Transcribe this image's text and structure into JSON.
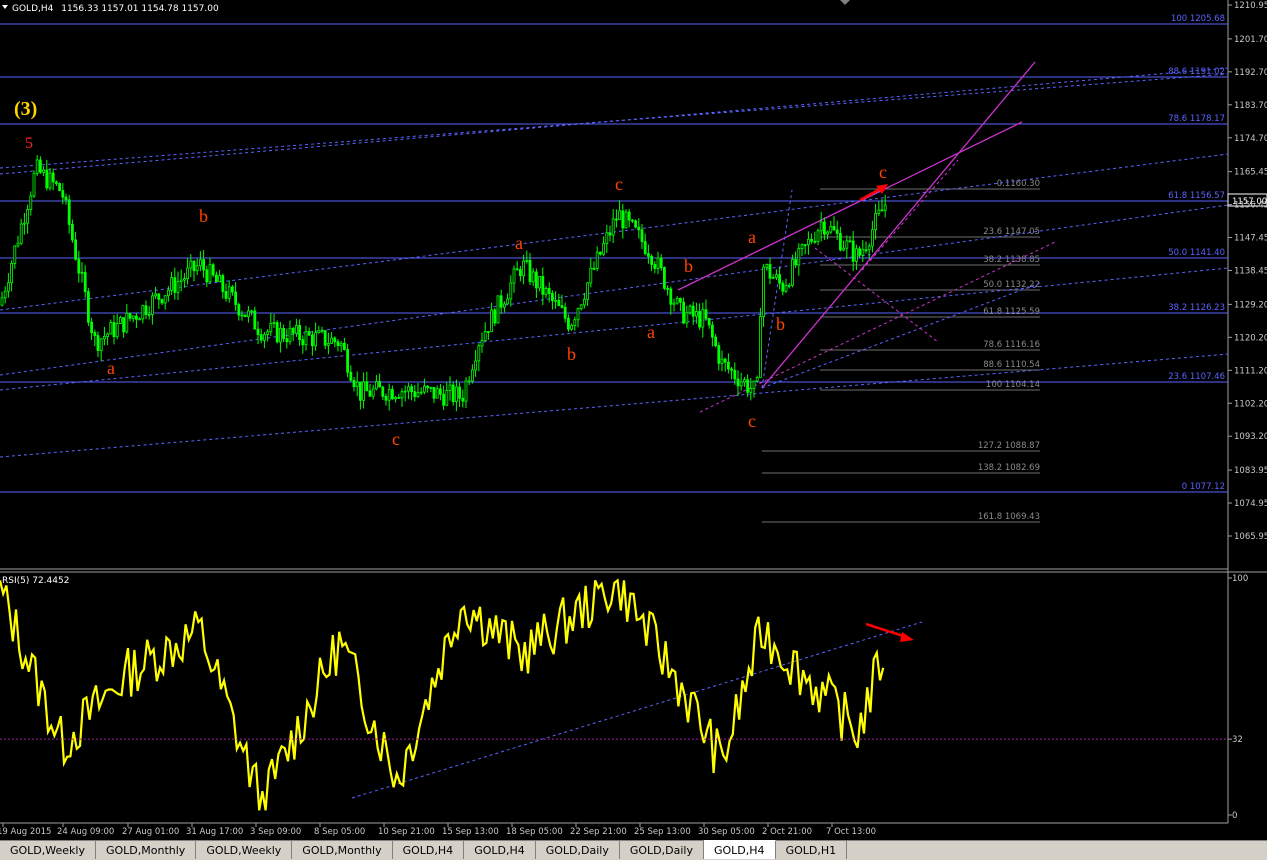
{
  "main_header": {
    "symbol_tf": "GOLD,H4",
    "ohlc": "1156.33 1157.01 1154.78 1157.00"
  },
  "rsi_header": "RSI(5) 72.4452",
  "wave_labels": {
    "primary": "(3)",
    "five": "5",
    "small": [
      "a",
      "b",
      "c",
      "a",
      "b",
      "c",
      "a",
      "b",
      "a",
      "b",
      "c",
      "c"
    ]
  },
  "price_axis": {
    "ticks": [
      "1210.95",
      "1201.70",
      "1192.70",
      "1183.70",
      "1174.70",
      "1165.45",
      "1156.45",
      "1147.45",
      "1138.45",
      "1129.20",
      "1120.20",
      "1111.20",
      "1102.20",
      "1093.20",
      "1083.95",
      "1074.95",
      "1065.95"
    ],
    "current": "1157.00"
  },
  "rsi_axis": {
    "ticks": [
      "100",
      "32",
      "0"
    ]
  },
  "time_axis": {
    "ticks": [
      "19 Aug 2015",
      "24 Aug 09:00",
      "27 Aug 01:00",
      "31 Aug 17:00",
      "3 Sep 09:00",
      "8 Sep 05:00",
      "10 Sep 21:00",
      "15 Sep 13:00",
      "18 Sep 05:00",
      "22 Sep 21:00",
      "25 Sep 13:00",
      "30 Sep 05:00",
      "2 Oct 21:00",
      "7 Oct 13:00"
    ]
  },
  "fib_blue": [
    "100 1205.68",
    "88.6 1191.02",
    "78.6 1178.17",
    "61.8 1156.57",
    "50.0 1141.40",
    "38.2 1126.23",
    "23.6 1107.46",
    "0 1077.12"
  ],
  "fib_gray": [
    "0.1160.30",
    "23.6 1147.05",
    "38.2 1138.85",
    "50.0 1132.22",
    "61.8 1125.59",
    "78.6 1116.16",
    "88.6 1110.54",
    "100 1104.14",
    "127.2 1088.87",
    "138.2 1082.69",
    "161.8 1069.43"
  ],
  "tabs": [
    "GOLD,Weekly",
    "GOLD,Monthly",
    "GOLD,Weekly",
    "GOLD,Monthly",
    "GOLD,H4",
    "GOLD,H4",
    "GOLD,Daily",
    "GOLD,Daily",
    "GOLD,H4",
    "GOLD,H1"
  ],
  "active_tab": "GOLD,H4",
  "colors": {
    "candle": "#00ff00",
    "rsi": "#ffff00",
    "fib_blue": "#5a64ff",
    "wave_label": "#ff4500",
    "primary_label": "#ffd700",
    "trend_magenta": "#cc33cc",
    "arrow": "#ff0000"
  },
  "chart_data": {
    "type": "candlestick",
    "symbol": "GOLD",
    "timeframe": "H4",
    "price_ylim": [
      1060.0,
      1212.0
    ],
    "rsi_ylim": [
      0,
      100
    ],
    "rsi_level": 32,
    "close_anchors": [
      {
        "t": "19 Aug 2015",
        "price": 1129
      },
      {
        "t": "21 Aug",
        "price": 1166
      },
      {
        "t": "24 Aug 09:00",
        "price": 1160
      },
      {
        "t": "25 Aug",
        "price": 1119
      },
      {
        "t": "27 Aug 01:00",
        "price": 1125
      },
      {
        "t": "31 Aug 17:00",
        "price": 1140
      },
      {
        "t": "3 Sep 09:00",
        "price": 1122
      },
      {
        "t": "8 Sep 05:00",
        "price": 1119
      },
      {
        "t": "9 Sep",
        "price": 1105
      },
      {
        "t": "10 Sep 21:00",
        "price": 1106
      },
      {
        "t": "15 Sep 13:00",
        "price": 1104
      },
      {
        "t": "16 Sep",
        "price": 1119
      },
      {
        "t": "18 Sep 05:00",
        "price": 1140
      },
      {
        "t": "21 Sep",
        "price": 1124
      },
      {
        "t": "22 Sep 21:00",
        "price": 1154
      },
      {
        "t": "24 Sep",
        "price": 1144
      },
      {
        "t": "25 Sep 13:00",
        "price": 1127
      },
      {
        "t": "29 Sep",
        "price": 1125
      },
      {
        "t": "30 Sep 05:00",
        "price": 1113
      },
      {
        "t": "1 Oct",
        "price": 1105
      },
      {
        "t": "2 Oct 21:00",
        "price": 1140
      },
      {
        "t": "5 Oct",
        "price": 1134
      },
      {
        "t": "6 Oct",
        "price": 1152
      },
      {
        "t": "7 Oct 13:00",
        "price": 1142
      },
      {
        "t": "8 Oct",
        "price": 1157
      }
    ],
    "rsi_anchors": [
      {
        "t": "19 Aug 2015",
        "v": 95
      },
      {
        "t": "24 Aug 09:00",
        "v": 30
      },
      {
        "t": "27 Aug 01:00",
        "v": 60
      },
      {
        "t": "31 Aug 17:00",
        "v": 78
      },
      {
        "t": "3 Sep 09:00",
        "v": 5
      },
      {
        "t": "8 Sep 05:00",
        "v": 73
      },
      {
        "t": "10 Sep 21:00",
        "v": 15
      },
      {
        "t": "15 Sep 13:00",
        "v": 90
      },
      {
        "t": "18 Sep 05:00",
        "v": 68
      },
      {
        "t": "22 Sep 21:00",
        "v": 98
      },
      {
        "t": "25 Sep 13:00",
        "v": 55
      },
      {
        "t": "30 Sep 05:00",
        "v": 22
      },
      {
        "t": "2 Oct 21:00",
        "v": 78
      },
      {
        "t": "7 Oct 13:00",
        "v": 35
      },
      {
        "t": "8 Oct",
        "v": 72
      }
    ]
  }
}
